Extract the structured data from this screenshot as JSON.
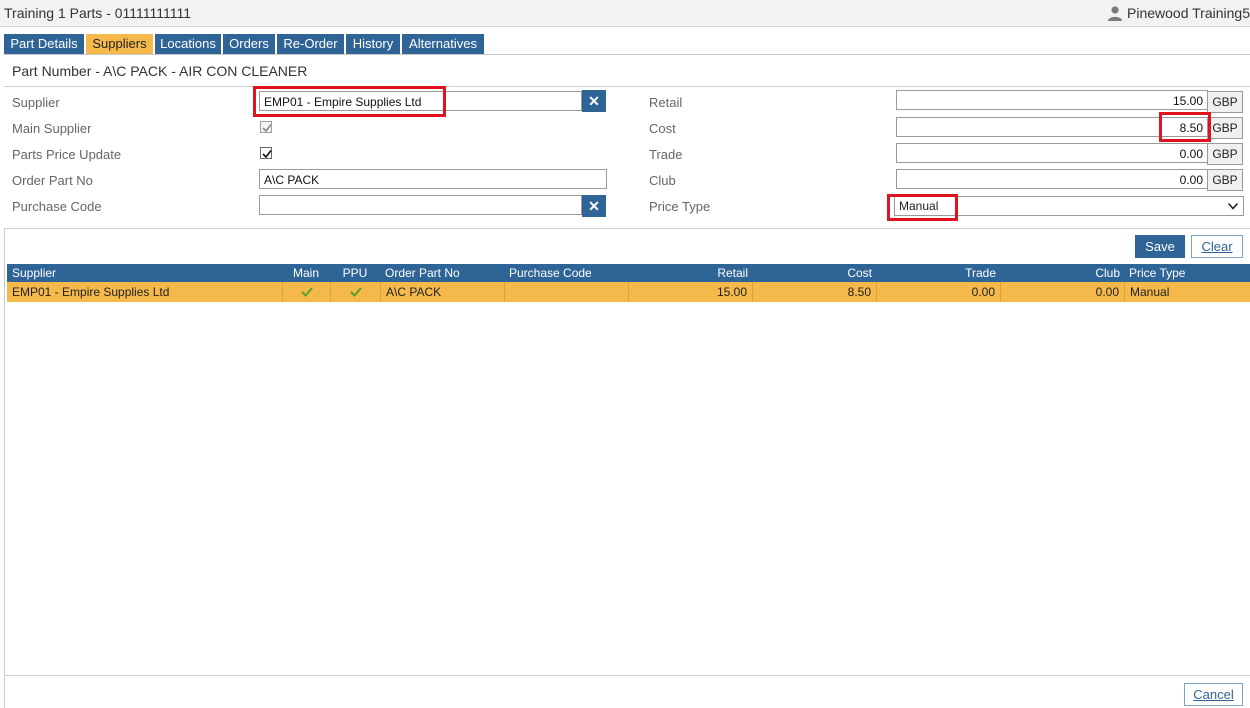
{
  "window": {
    "title": "Training 1 Parts - 01111111111",
    "user": "Pinewood Training5"
  },
  "tabs": [
    {
      "label": "Part Details"
    },
    {
      "label": "Suppliers",
      "active": true
    },
    {
      "label": "Locations"
    },
    {
      "label": "Orders"
    },
    {
      "label": "Re-Order"
    },
    {
      "label": "History"
    },
    {
      "label": "Alternatives"
    }
  ],
  "heading": "Part Number - A\\C PACK - AIR CON CLEANER",
  "form": {
    "supplier_label": "Supplier",
    "supplier_value": "EMP01 - Empire Supplies Ltd",
    "main_supplier_label": "Main Supplier",
    "main_supplier_checked": true,
    "ppu_label": "Parts Price Update",
    "ppu_checked": true,
    "order_part_no_label": "Order Part No",
    "order_part_no_value": "A\\C PACK",
    "purchase_code_label": "Purchase Code",
    "purchase_code_value": "",
    "retail_label": "Retail",
    "retail_value": "15.00",
    "cost_label": "Cost",
    "cost_value": "8.50",
    "trade_label": "Trade",
    "trade_value": "0.00",
    "club_label": "Club",
    "club_value": "0.00",
    "currency": "GBP",
    "price_type_label": "Price Type",
    "price_type_value": "Manual"
  },
  "buttons": {
    "save": "Save",
    "clear": "Clear",
    "cancel": "Cancel",
    "clear_x": "✕"
  },
  "table": {
    "columns": [
      "Supplier",
      "Main",
      "PPU",
      "Order Part No",
      "Purchase Code",
      "Retail",
      "Cost",
      "Trade",
      "Club",
      "Price Type"
    ],
    "rows": [
      {
        "supplier": "EMP01 - Empire Supplies Ltd",
        "main": true,
        "ppu": true,
        "order_part_no": "A\\C PACK",
        "purchase_code": "",
        "retail": "15.00",
        "cost": "8.50",
        "trade": "0.00",
        "club": "0.00",
        "price_type": "Manual"
      }
    ]
  },
  "colors": {
    "header_blue": "#2f6496",
    "highlight_orange": "#f5b94b",
    "annotation_red": "#e0141e"
  }
}
